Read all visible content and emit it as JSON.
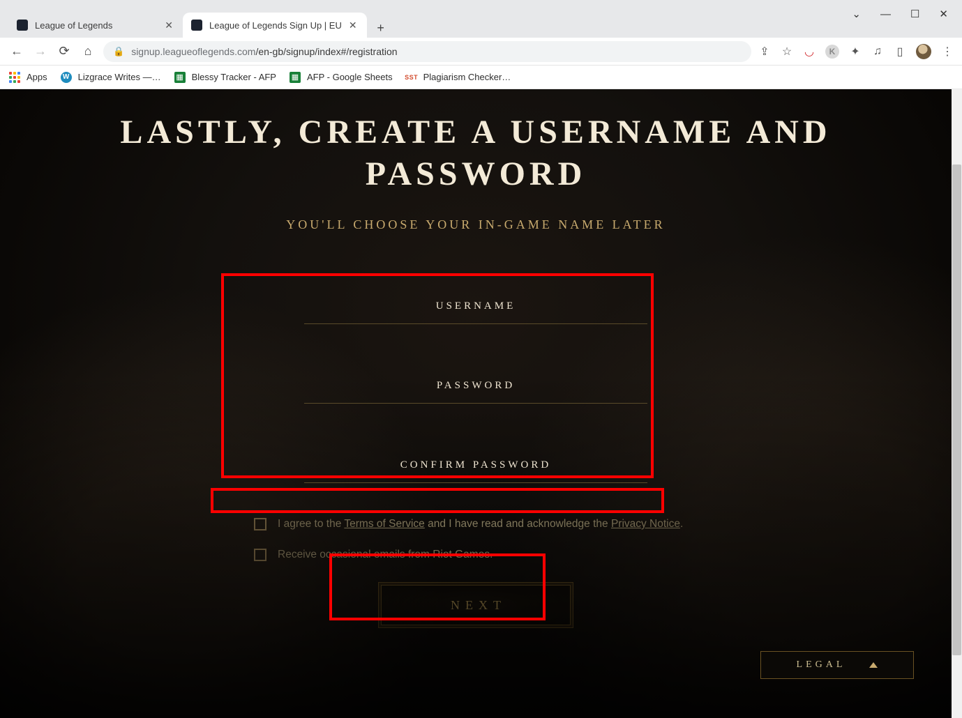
{
  "window": {
    "dropdown_icon": "⌄",
    "minimize_icon": "—",
    "maximize_icon": "☐",
    "close_icon": "✕"
  },
  "tabs": [
    {
      "title": "League of Legends",
      "active": false
    },
    {
      "title": "League of Legends Sign Up | EU",
      "active": true
    }
  ],
  "newtab_icon": "+",
  "nav": {
    "back": "←",
    "forward": "→",
    "reload": "⟳",
    "home": "⌂"
  },
  "omnibox": {
    "lock": "🔒",
    "host": "signup.leagueoflegends.com",
    "path": "/en-gb/signup/index#/registration"
  },
  "toolbar_icons": {
    "share": "⇪",
    "star": "☆",
    "mcafee": "◡",
    "greyk": "K",
    "ext": "✦",
    "reading": "♫",
    "panel": "▯",
    "menu": "⋮"
  },
  "bookmarks": [
    {
      "kind": "apps",
      "label": "Apps"
    },
    {
      "kind": "wp",
      "label": "Lizgrace Writes —…"
    },
    {
      "kind": "sheets",
      "label": "Blessy Tracker - AFP"
    },
    {
      "kind": "sheets",
      "label": "AFP - Google Sheets"
    },
    {
      "kind": "sst",
      "label": "Plagiarism Checker…"
    }
  ],
  "page": {
    "h1_line1": "LASTLY, CREATE A USERNAME AND",
    "h1_line2": "PASSWORD",
    "subhead": "YOU'LL CHOOSE YOUR IN-GAME NAME LATER",
    "fields": {
      "username_label": "USERNAME",
      "password_label": "PASSWORD",
      "confirm_label": "CONFIRM PASSWORD"
    },
    "tos": {
      "pre": "I agree to the ",
      "tos_link": "Terms of Service",
      "mid": " and I have read and acknowledge the ",
      "priv_link": "Privacy Notice",
      "post": "."
    },
    "emails_label": "Receive occasional emails from Riot Games.",
    "next_label": "NEXT",
    "legal_label": "LEGAL"
  },
  "scrollbar": {
    "thumb_top_pct": 12,
    "thumb_height_pct": 78
  },
  "colors": {
    "gold": "#c8aa6e",
    "cream": "#f0e6d2",
    "gold_dim": "#cdbe91"
  }
}
